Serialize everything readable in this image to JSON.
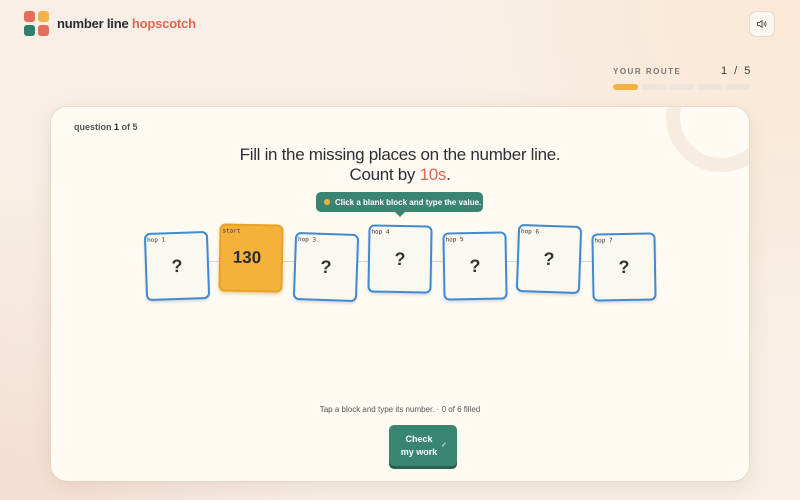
{
  "header": {
    "brand_part1": "number line",
    "brand_part2": "hopscotch",
    "sound_icon": "speaker-icon"
  },
  "route": {
    "label": "YOUR ROUTE",
    "count": "1 / 5",
    "segments_total": 5,
    "segments_done": 1
  },
  "question": {
    "label": "question",
    "number": "1",
    "of_text": "of 5",
    "prompt_line1": "Fill in the missing places on the number line.",
    "prompt_line2_prefix": "Count by ",
    "prompt_accent": "10s",
    "prompt_line2_suffix": "."
  },
  "tooltip": {
    "text": "Click a blank block and type the value."
  },
  "tiles": [
    {
      "tag": "hop 1",
      "value": "?"
    },
    {
      "tag": "start",
      "value": "130"
    },
    {
      "tag": "hop 3",
      "value": "?"
    },
    {
      "tag": "hop 4",
      "value": "?"
    },
    {
      "tag": "hop 5",
      "value": "?"
    },
    {
      "tag": "hop 6",
      "value": "?"
    },
    {
      "tag": "hop 7",
      "value": "?"
    }
  ],
  "status": {
    "text": "Tap a block and type its number. · 0 of 6 filled"
  },
  "check_button": {
    "label": "Check my work",
    "icon": "check-icon"
  },
  "colors": {
    "accent_orange": "#e0664f",
    "start_tile": "#f4b239",
    "tile_border": "#3f8ad1",
    "button_green": "#3a8472"
  }
}
